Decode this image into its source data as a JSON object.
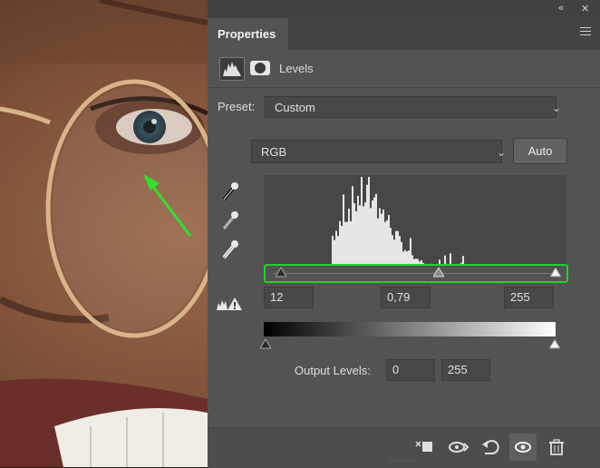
{
  "panel": {
    "tab_label": "Properties",
    "adjustment_title": "Levels",
    "preset_label": "Preset:",
    "preset_value": "Custom",
    "channel_value": "RGB",
    "auto_button": "Auto",
    "input_shadow": "12",
    "input_midtone": "0,79",
    "input_highlight": "255",
    "output_label": "Output Levels:",
    "output_black": "0",
    "output_white": "255"
  },
  "colors": {
    "panel_bg": "#535353",
    "highlight_box": "#22d22c",
    "annotation_arrow": "#31e02b"
  },
  "icons": [
    "collapse-icon",
    "close-icon",
    "panel-menu-icon",
    "histogram-icon",
    "mask-icon",
    "dropdown-chevron-icon",
    "black-eyedropper-icon",
    "gray-eyedropper-icon",
    "white-eyedropper-icon",
    "clipping-warning-icon",
    "clip-to-layer-icon",
    "view-previous-icon",
    "reset-icon",
    "visibility-icon",
    "trash-icon"
  ]
}
